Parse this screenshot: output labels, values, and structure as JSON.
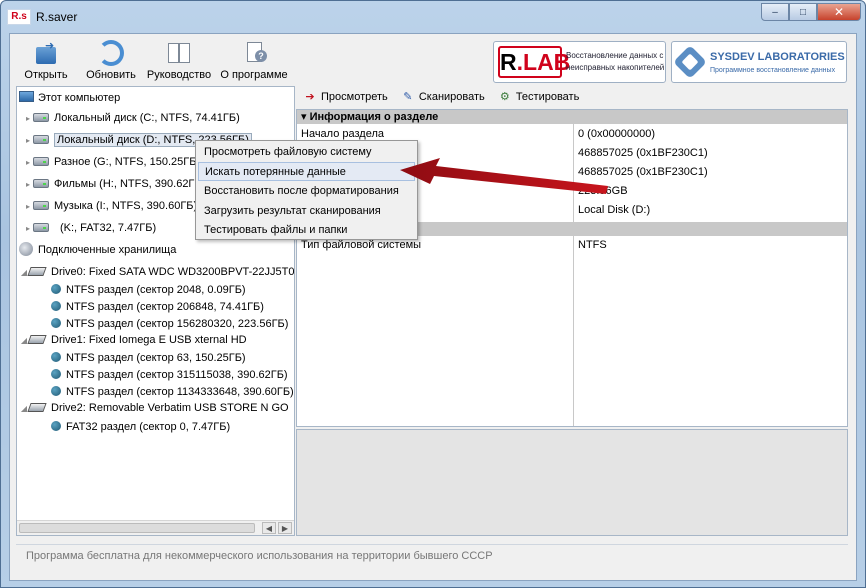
{
  "window": {
    "icon_text": "R.s",
    "title": "R.saver",
    "controls": {
      "minimize": "–",
      "maximize": "□",
      "close": "✕"
    }
  },
  "toolbar": {
    "open": "Открыть",
    "refresh": "Обновить",
    "manual": "Руководство",
    "about": "О программе"
  },
  "logos": {
    "rlab": {
      "mark_r": "R",
      "mark_lab": ".LAB",
      "text": "Восстановление данных с неисправных накопителей"
    },
    "sysdev": {
      "name": "SYSDEV LABORATORIES",
      "tagline": "Программное восстановление данных"
    }
  },
  "tree": {
    "computer": "Этот компьютер",
    "disks": [
      "Локальный диск (C:, NTFS, 74.41ГБ)",
      "Локальный диск (D:, NTFS, 223.56ГБ)",
      "Разное (G:, NTFS, 150.25ГБ)",
      "Фильмы (H:, NTFS, 390.62ГБ)",
      "Музыка (I:, NTFS, 390.60ГБ)",
      "(K:, FAT32, 7.47ГБ)"
    ],
    "storages": "Подключенные хранилища",
    "drives": [
      {
        "name": "Drive0: Fixed SATA WDC WD3200BPVT-22JJ5T0",
        "parts": [
          "NTFS раздел (сектор 2048, 0.09ГБ)",
          "NTFS раздел (сектор 206848, 74.41ГБ)",
          "NTFS раздел (сектор 156280320, 223.56ГБ)"
        ]
      },
      {
        "name": "Drive1: Fixed Iomega E USB xternal HD",
        "parts": [
          "NTFS раздел (сектор 63, 150.25ГБ)",
          "NTFS раздел (сектор 315115038, 390.62ГБ)",
          "NTFS раздел (сектор 1134333648, 390.60ГБ)"
        ]
      },
      {
        "name": "Drive2: Removable Verbatim USB STORE N GO",
        "parts": [
          "FAT32 раздел (сектор 0, 7.47ГБ)"
        ]
      }
    ]
  },
  "actions": {
    "view": "Просмотреть",
    "scan": "Сканировать",
    "test": "Тестировать"
  },
  "info": {
    "header": "Информация о разделе",
    "rows": [
      {
        "key": "Начало раздела",
        "value": "0 (0x00000000)"
      },
      {
        "key": "",
        "value": "468857025 (0x1BF230C1)"
      },
      {
        "key": "",
        "value": "468857025 (0x1BF230C1)"
      },
      {
        "key": "",
        "value": "223.56GB"
      },
      {
        "key": "",
        "value": "Local Disk (D:)"
      }
    ],
    "fs_row": {
      "key": "Тип файловой системы",
      "value": "NTFS"
    }
  },
  "context_menu": [
    "Просмотреть файловую систему",
    "Искать потерянные данные",
    "Восстановить после форматирования",
    "Загрузить результат сканирования",
    "Тестировать файлы и папки"
  ],
  "status": "Программа бесплатна для некоммерческого использования на территории бывшего СССР",
  "colors": {
    "accent_red": "#c1121f",
    "rlab_red": "#d0021b",
    "sysdev_blue": "#3a6aa8"
  }
}
